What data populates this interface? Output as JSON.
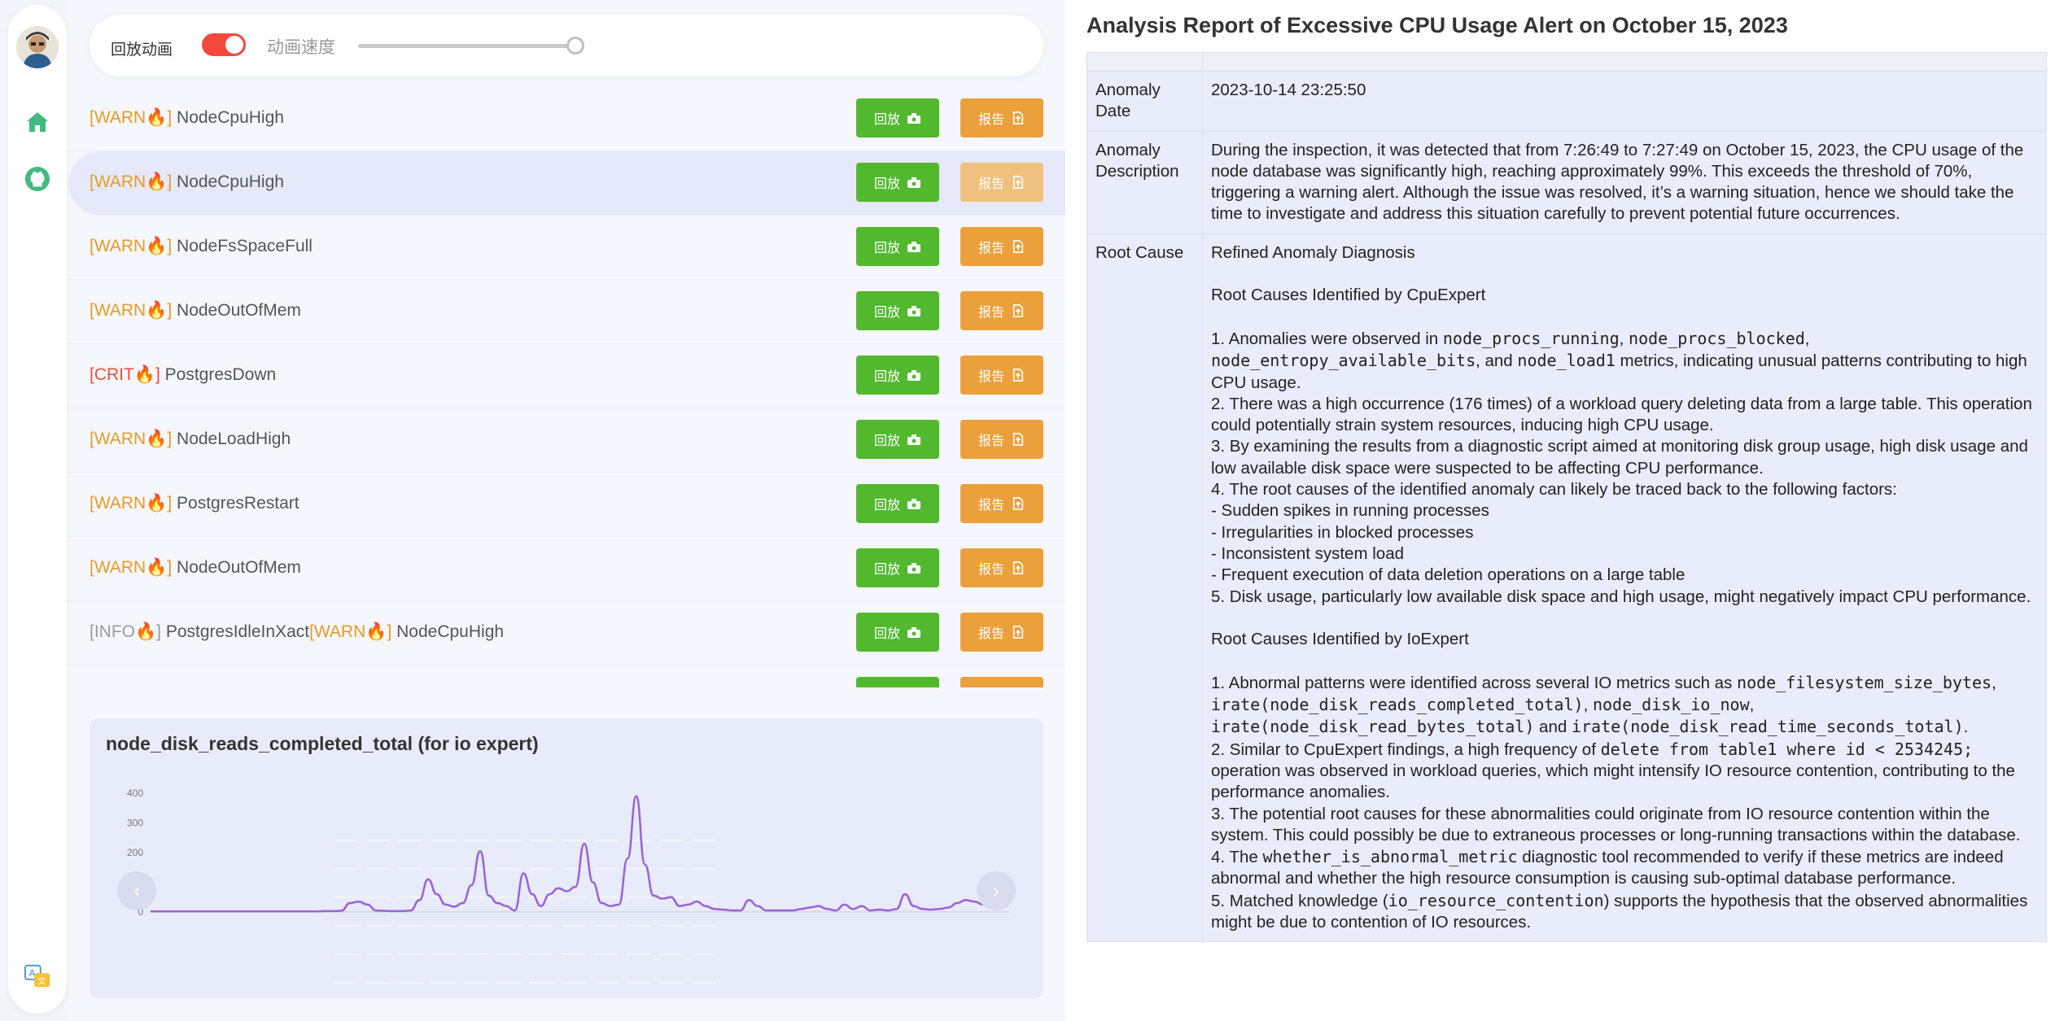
{
  "controls": {
    "replay_anim_label": "回放动画",
    "replay_anim_on": true,
    "speed_label": "动画速度",
    "speed_value": 1.0
  },
  "alerts": [
    {
      "parts": [
        {
          "tag": "[WARN🔥]",
          "level": "warn"
        },
        {
          "name": " NodeCpuHigh"
        }
      ],
      "replay": "回放",
      "report": "报告",
      "selected": false
    },
    {
      "parts": [
        {
          "tag": "[WARN🔥]",
          "level": "warn"
        },
        {
          "name": " NodeCpuHigh"
        }
      ],
      "replay": "回放",
      "report": "报告",
      "selected": true
    },
    {
      "parts": [
        {
          "tag": "[WARN🔥]",
          "level": "warn"
        },
        {
          "name": " NodeFsSpaceFull"
        }
      ],
      "replay": "回放",
      "report": "报告",
      "selected": false
    },
    {
      "parts": [
        {
          "tag": "[WARN🔥]",
          "level": "warn"
        },
        {
          "name": " NodeOutOfMem"
        }
      ],
      "replay": "回放",
      "report": "报告",
      "selected": false
    },
    {
      "parts": [
        {
          "tag": "[CRIT🔥]",
          "level": "crit"
        },
        {
          "name": " PostgresDown"
        }
      ],
      "replay": "回放",
      "report": "报告",
      "selected": false
    },
    {
      "parts": [
        {
          "tag": "[WARN🔥]",
          "level": "warn"
        },
        {
          "name": " NodeLoadHigh"
        }
      ],
      "replay": "回放",
      "report": "报告",
      "selected": false
    },
    {
      "parts": [
        {
          "tag": "[WARN🔥]",
          "level": "warn"
        },
        {
          "name": " PostgresRestart"
        }
      ],
      "replay": "回放",
      "report": "报告",
      "selected": false
    },
    {
      "parts": [
        {
          "tag": "[WARN🔥]",
          "level": "warn"
        },
        {
          "name": " NodeOutOfMem"
        }
      ],
      "replay": "回放",
      "report": "报告",
      "selected": false
    },
    {
      "parts": [
        {
          "tag": "[INFO🔥]",
          "level": "info"
        },
        {
          "name": " PostgresIdleInXact"
        },
        {
          "tag": "[WARN🔥]",
          "level": "warn"
        },
        {
          "name": " NodeCpuHigh"
        }
      ],
      "replay": "回放",
      "report": "报告",
      "selected": false
    },
    {
      "parts": [
        {
          "name": ""
        }
      ],
      "replay": "回放",
      "report": "报告",
      "selected": false
    }
  ],
  "chart_data": {
    "type": "line",
    "title": "node_disk_reads_completed_total (for io expert)",
    "xlabel": "",
    "ylabel": "",
    "ylim": [
      0,
      400
    ],
    "yticks": [
      0,
      100,
      200,
      300,
      400
    ],
    "grid": false,
    "color": "#9a62d6",
    "series": [
      {
        "values": [
          2,
          2,
          2,
          2,
          2,
          2,
          2,
          2,
          2,
          2,
          2,
          2,
          2,
          2,
          2,
          2,
          2,
          2,
          2,
          2,
          3,
          3,
          4,
          30,
          35,
          25,
          5,
          4,
          3,
          3,
          5,
          40,
          110,
          60,
          25,
          18,
          30,
          90,
          205,
          55,
          30,
          20,
          5,
          130,
          60,
          20,
          60,
          80,
          70,
          85,
          230,
          100,
          30,
          20,
          25,
          180,
          390,
          160,
          55,
          45,
          50,
          20,
          25,
          35,
          20,
          10,
          8,
          5,
          5,
          40,
          20,
          5,
          5,
          5,
          5,
          10,
          15,
          20,
          10,
          5,
          25,
          10,
          20,
          5,
          8,
          5,
          10,
          60,
          20,
          10,
          8,
          10,
          15,
          30,
          40,
          35,
          25,
          20,
          15,
          25
        ]
      }
    ]
  },
  "report": {
    "title": "Analysis Report of Excessive CPU Usage Alert on October 15, 2023",
    "date_label": "Anomaly Date",
    "date_value": "2023-10-14 23:25:50",
    "desc_label": "Anomaly Description",
    "desc_value": "During the inspection, it was detected that from 7:26:49 to 7:27:49 on October 15, 2023, the CPU usage of the node database was significantly high, reaching approximately 99%. This exceeds the threshold of 70%, triggering a warning alert. Although the issue was resolved, it’s a warning situation, hence we should take the time to investigate and address this situation carefully to prevent potential future occurrences.",
    "cause_label": "Root Cause",
    "cause_lines": [
      [
        {
          "t": "Refined Anomaly Diagnosis"
        }
      ],
      [
        {
          "t": ""
        }
      ],
      [
        {
          "t": "Root Causes Identified by CpuExpert"
        }
      ],
      [
        {
          "t": ""
        }
      ],
      [
        {
          "t": "1. Anomalies were observed in "
        },
        {
          "c": "node_procs_running"
        },
        {
          "t": ", "
        },
        {
          "c": "node_procs_blocked"
        },
        {
          "t": ", "
        },
        {
          "c": "node_entropy_available_bits"
        },
        {
          "t": ", and "
        },
        {
          "c": "node_load1"
        },
        {
          "t": " metrics, indicating unusual patterns contributing to high CPU usage."
        }
      ],
      [
        {
          "t": "2. There was a high occurrence (176 times) of a workload query deleting data from a large table. This operation could potentially strain system resources, inducing high CPU usage."
        }
      ],
      [
        {
          "t": "3. By examining the results from a diagnostic script aimed at monitoring disk group usage, high disk usage and low available disk space were suspected to be affecting CPU performance."
        }
      ],
      [
        {
          "t": "4. The root causes of the identified anomaly can likely be traced back to the following factors:"
        }
      ],
      [
        {
          "t": "- Sudden spikes in running processes"
        }
      ],
      [
        {
          "t": "- Irregularities in blocked processes"
        }
      ],
      [
        {
          "t": "- Inconsistent system load"
        }
      ],
      [
        {
          "t": "- Frequent execution of data deletion operations on a large table"
        }
      ],
      [
        {
          "t": "5. Disk usage, particularly low available disk space and high usage, might negatively impact CPU performance."
        }
      ],
      [
        {
          "t": ""
        }
      ],
      [
        {
          "t": "Root Causes Identified by IoExpert"
        }
      ],
      [
        {
          "t": ""
        }
      ],
      [
        {
          "t": "1. Abnormal patterns were identified across several IO metrics such as "
        },
        {
          "c": "node_filesystem_size_bytes"
        },
        {
          "t": ", "
        },
        {
          "c": "irate(node_disk_reads_completed_total)"
        },
        {
          "t": ", "
        },
        {
          "c": "node_disk_io_now"
        },
        {
          "t": ", "
        },
        {
          "c": "irate(node_disk_read_bytes_total)"
        },
        {
          "t": " and "
        },
        {
          "c": "irate(node_disk_read_time_seconds_total)"
        },
        {
          "t": "."
        }
      ],
      [
        {
          "t": "2. Similar to CpuExpert findings, a high frequency of "
        },
        {
          "c": "delete from table1 where id < 2534245;"
        },
        {
          "t": " operation was observed in workload queries, which might intensify IO resource contention, contributing to the performance anomalies."
        }
      ],
      [
        {
          "t": "3. The potential root causes for these abnormalities could originate from IO resource contention within the system. This could possibly be due to extraneous processes or long-running transactions within the database."
        }
      ],
      [
        {
          "t": "4. The "
        },
        {
          "c": "whether_is_abnormal_metric"
        },
        {
          "t": " diagnostic tool recommended to verify if these metrics are indeed abnormal and whether the high resource consumption is causing sub-optimal database performance."
        }
      ],
      [
        {
          "t": "5. Matched knowledge ("
        },
        {
          "c": "io_resource_contention"
        },
        {
          "t": ") supports the hypothesis that the observed abnormalities might be due to contention of IO resources."
        }
      ]
    ]
  }
}
